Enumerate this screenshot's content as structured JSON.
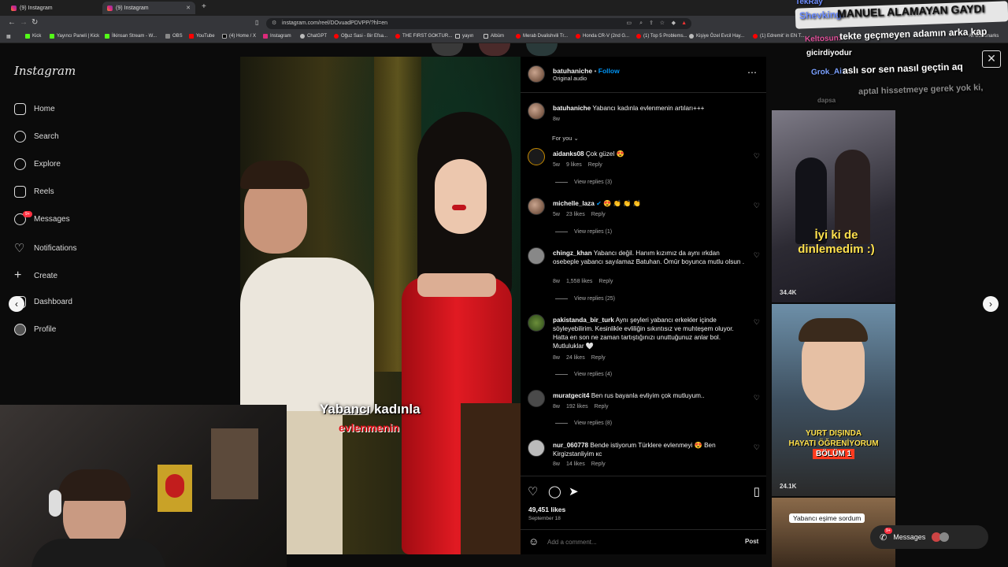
{
  "browser": {
    "tabs": [
      {
        "label": "(9) Instagram",
        "active": false
      },
      {
        "label": "(9) Instagram",
        "active": true
      }
    ],
    "url": "instagram.com/reel/DOvuadPDVPP/?hl=en",
    "bookmarks": [
      "Kick",
      "Yayıncı Paneli | Kick",
      "İlkinsan Stream - W...",
      "OBS",
      "YouTube",
      "(4) Home / X",
      "Instagram",
      "ChatGPT",
      "Oğuz Sasi - Bir Efsa...",
      "THE FIRST GOKTUR...",
      "yayın",
      "Albüm",
      "Merab Dvalishvili Tr...",
      "Honda CR-V (2nd G...",
      "(1) Top 5 Problems...",
      "Kişiye Özel Evcil Hay...",
      "(1) Edremit' in EN T..."
    ],
    "all_bookmarks": "All Bookmarks"
  },
  "sidebar": {
    "logo": "Instagram",
    "items": [
      {
        "label": "Home",
        "icon": "home-icon"
      },
      {
        "label": "Search",
        "icon": "search-icon"
      },
      {
        "label": "Explore",
        "icon": "compass-icon"
      },
      {
        "label": "Reels",
        "icon": "reels-icon"
      },
      {
        "label": "Messages",
        "icon": "messenger-icon",
        "badge": "9+"
      },
      {
        "label": "Notifications",
        "icon": "heart-icon"
      },
      {
        "label": "Create",
        "icon": "plus-icon"
      },
      {
        "label": "Dashboard",
        "icon": "dashboard-icon"
      },
      {
        "label": "Profile",
        "icon": "profile-icon"
      }
    ]
  },
  "video": {
    "caption_line1": "Yabancı kadınla",
    "caption_line2": "evlenmenin"
  },
  "post": {
    "author": "batuhaniche",
    "follow": "Follow",
    "audio": "Original audio",
    "caption_user": "batuhaniche",
    "caption_text": "Yabancı kadınla evlenmenin artıları+++",
    "caption_age": "8w",
    "sort": "For you",
    "likes": "49,451 likes",
    "date": "September 18",
    "add_comment_placeholder": "Add a comment...",
    "post_button": "Post"
  },
  "comments": [
    {
      "user": "aidanks08",
      "text": "Çok güzel 😍",
      "age": "5w",
      "likes": "9 likes",
      "reply": "Reply",
      "replies": "View replies (3)"
    },
    {
      "user": "michelle_laza",
      "text": "😍 👏 👏 👏",
      "age": "5w",
      "likes": "23 likes",
      "reply": "Reply",
      "replies": "View replies (1)"
    },
    {
      "user": "chingz_khan",
      "text": "Yabancı değil. Hanım kızımız da aynı ırkdan osebeple yabancı sayılamaz Batuhan. Ömür boyunca mutlu olsun .",
      "age": "8w",
      "likes": "1,558 likes",
      "reply": "Reply",
      "replies": "View replies (25)"
    },
    {
      "user": "pakistanda_bir_turk",
      "text": "Aynı şeyleri yabancı erkekler içinde söyleyebilirim. Kesinlikle evliliğin sıkıntısız ve muhteşem oluyor. Hatta en son ne zaman tartıştığınızı unuttuğunuz anlar bol. Mutluluklar 🤍",
      "age": "8w",
      "likes": "24 likes",
      "reply": "Reply",
      "replies": "View replies (4)"
    },
    {
      "user": "muratgecit4",
      "text": "Ben rus bayanla evliyim çok mutluyum..",
      "age": "8w",
      "likes": "192 likes",
      "reply": "Reply",
      "replies": "View replies (8)"
    },
    {
      "user": "nur_060778",
      "text": "Bende istiyorum Türklere evlenmeyi 😍 Ben Kirgizstanliyim кс",
      "age": "8w",
      "likes": "14 likes",
      "reply": "Reply",
      "replies": ""
    }
  ],
  "thumbnails": [
    {
      "caption": "İyi ki de dinlemedim :)",
      "views": "34.4K"
    },
    {
      "caption_line1": "YURT DIŞINDA",
      "caption_line2": "HAYATI ÖĞRENİYORUM",
      "caption_line3": "BÖLÜM 1",
      "views": "24.1K"
    },
    {
      "caption": "Yabancı eşime sordum"
    }
  ],
  "messages_pill": {
    "label": "Messages",
    "badge": "9+"
  },
  "stream_chat": [
    {
      "user": "TekRay",
      "text": ""
    },
    {
      "user": "Shevking:",
      "text": "MANUEL ALAMAYAN GAYDI"
    },
    {
      "user": "Keltosun:",
      "text": "tekte geçmeyen adamın arka kap"
    },
    {
      "user": "",
      "text": "gicirdiyodur"
    },
    {
      "user": "Grok_Ai:",
      "text": "aslı sor sen nasıl geçtin aq"
    },
    {
      "user": "",
      "text": "aptal hissetmeye gerek yok ki,"
    },
    {
      "user": "",
      "text": "dapsa"
    }
  ],
  "colors": {
    "accent": "#0095f6",
    "badge": "#ff3040",
    "caption_red": "#e0111b"
  }
}
